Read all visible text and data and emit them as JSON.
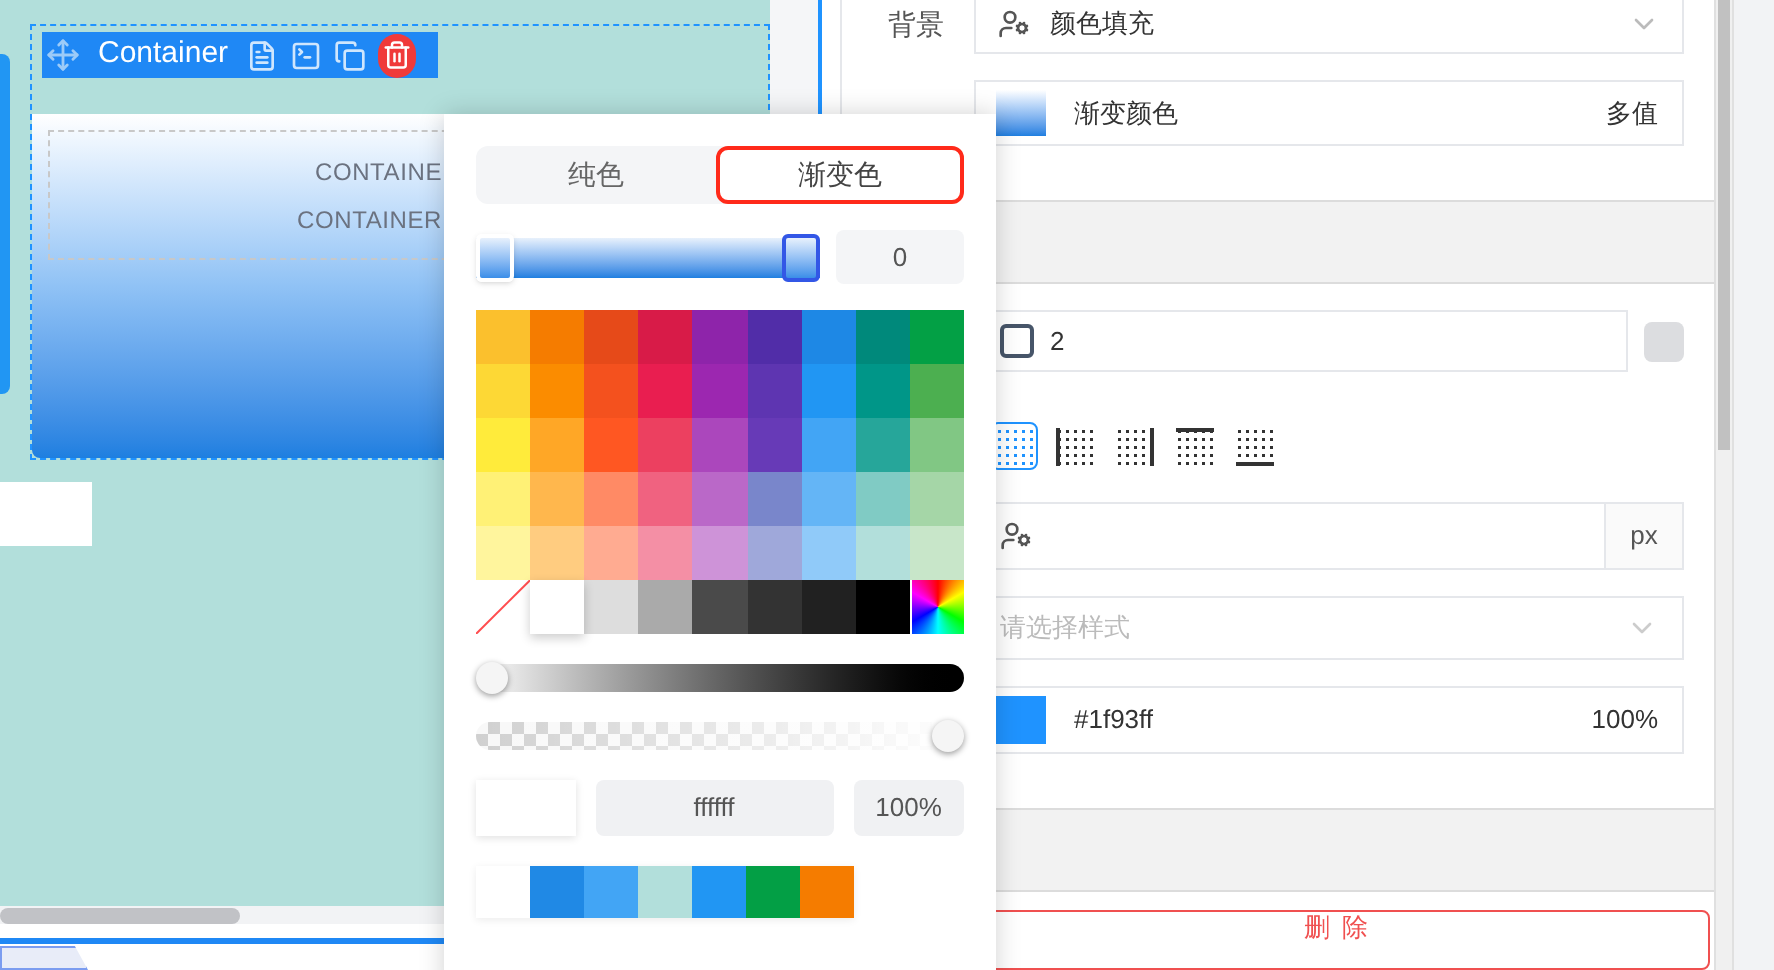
{
  "canvas": {
    "toolbar": {
      "title": "Container"
    },
    "inner_texts": [
      "CONTAINE",
      "CONTAINER"
    ]
  },
  "properties": {
    "background": {
      "label": "背景",
      "value": "颜色填充"
    },
    "color": {
      "value": "渐变颜色",
      "note": "多值"
    },
    "border": {
      "width": {
        "checked": false,
        "value": "2"
      },
      "sides": [
        {
          "kind": "all",
          "selected": true
        },
        {
          "kind": "left",
          "selected": false
        },
        {
          "kind": "right",
          "selected": false
        },
        {
          "kind": "top",
          "selected": false
        },
        {
          "kind": "bottom",
          "selected": false
        }
      ],
      "unit": "px",
      "style_placeholder": "请选择样式",
      "color": {
        "value": "#1f93ff",
        "opacity": "100%"
      }
    },
    "delete_button": "删除"
  },
  "color_picker": {
    "tabs": [
      {
        "label": "纯色",
        "selected": false
      },
      {
        "label": "渐变色",
        "selected": true
      }
    ],
    "gradient": {
      "stops": [
        {
          "level": 0,
          "selected": false
        },
        {
          "level": 1,
          "selected": true
        }
      ],
      "angle": "0"
    },
    "palette": [
      {
        "swatches": [
          {
            "color": "#fbc02d"
          },
          {
            "color": "#f57c00"
          },
          {
            "color": "#e64a19"
          },
          {
            "color": "#d81b48"
          },
          {
            "color": "#8e24aa"
          },
          {
            "color": "#512da8"
          },
          {
            "color": "#1e88e5"
          },
          {
            "color": "#00897b"
          },
          {
            "color": "#03a045"
          }
        ]
      },
      {
        "swatches": [
          {
            "color": "#fdd835"
          },
          {
            "color": "#fb8c00"
          },
          {
            "color": "#f4511e"
          },
          {
            "color": "#e91e50"
          },
          {
            "color": "#9c27b0"
          },
          {
            "color": "#5e35b1"
          },
          {
            "color": "#2196f3"
          },
          {
            "color": "#009688"
          },
          {
            "color": "#4caf50"
          }
        ]
      },
      {
        "swatches": [
          {
            "color": "#ffeb3b"
          },
          {
            "color": "#ffa726"
          },
          {
            "color": "#ff5722"
          },
          {
            "color": "#ec4060"
          },
          {
            "color": "#ab47bc"
          },
          {
            "color": "#673ab7"
          },
          {
            "color": "#42a5f5"
          },
          {
            "color": "#26a69a"
          },
          {
            "color": "#81c784"
          }
        ]
      },
      {
        "swatches": [
          {
            "color": "#fff176"
          },
          {
            "color": "#ffb74d"
          },
          {
            "color": "#ff8a65"
          },
          {
            "color": "#f06280"
          },
          {
            "color": "#ba68c8"
          },
          {
            "color": "#7986cb"
          },
          {
            "color": "#64b5f6"
          },
          {
            "color": "#80cbc4"
          },
          {
            "color": "#a5d6a7"
          }
        ]
      },
      {
        "swatches": [
          {
            "color": "#fff59d"
          },
          {
            "color": "#ffcc80"
          },
          {
            "color": "#ffab91"
          },
          {
            "color": "#f48fa5"
          },
          {
            "color": "#ce93d8"
          },
          {
            "color": "#9fa8da"
          },
          {
            "color": "#90caf9"
          },
          {
            "color": "#b2dfdb"
          },
          {
            "color": "#c8e6c9"
          }
        ]
      }
    ],
    "bottom_row": [
      {
        "kind": "none",
        "selected": false
      },
      {
        "kind": "color",
        "color": "#ffffff",
        "selected": true
      },
      {
        "kind": "color",
        "color": "#dddddd",
        "selected": false
      },
      {
        "kind": "color",
        "color": "#aaaaaa",
        "selected": false
      },
      {
        "kind": "color",
        "color": "#4a4a4a",
        "selected": false
      },
      {
        "kind": "color",
        "color": "#333333",
        "selected": false
      },
      {
        "kind": "color",
        "color": "#212121",
        "selected": false
      },
      {
        "kind": "color",
        "color": "#000000",
        "selected": false
      },
      {
        "kind": "rainbow",
        "selected": false
      }
    ],
    "shade": {
      "level": 0
    },
    "alpha": {
      "level": 1
    },
    "hex": "ffffff",
    "opacity": "100%",
    "recent": [
      {
        "color": "#ffffff"
      },
      {
        "color": "#2089e5"
      },
      {
        "color": "#42a5f5"
      },
      {
        "color": "#b2dfdb"
      },
      {
        "color": "#2196f3"
      },
      {
        "color": "#039f45"
      },
      {
        "color": "#f57c00"
      }
    ]
  }
}
